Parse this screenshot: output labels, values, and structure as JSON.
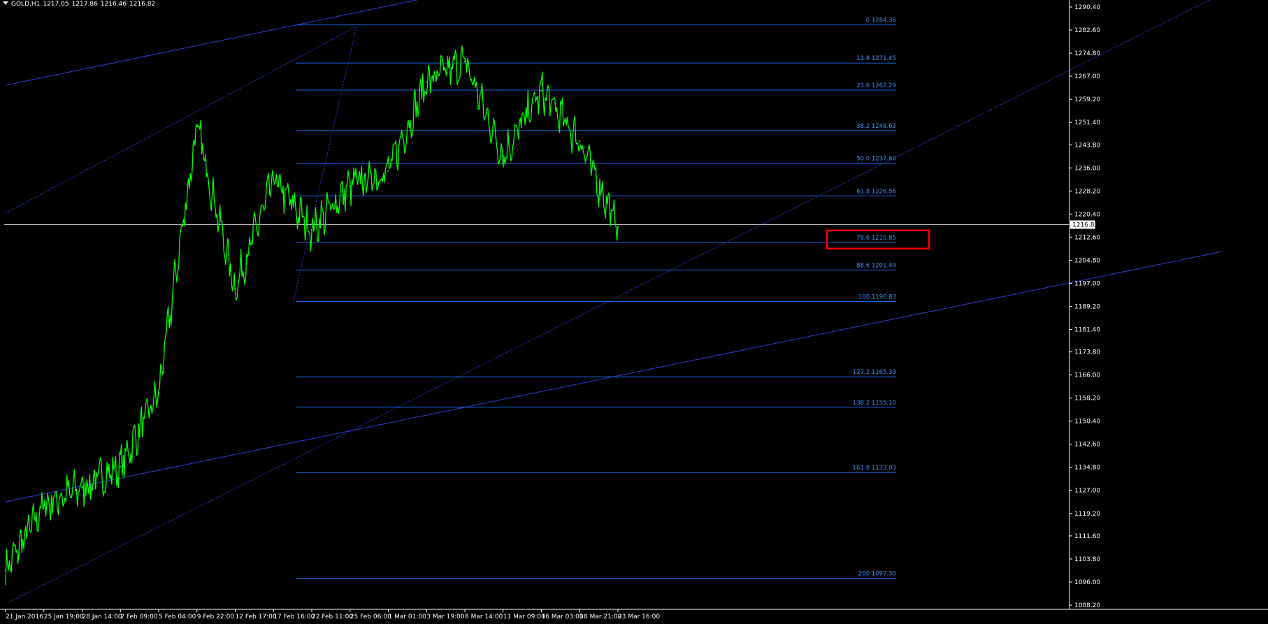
{
  "header": {
    "symbol": "GOLD,H1",
    "open": "1217.05",
    "high": "1217.86",
    "low": "1216.46",
    "close": "1216.82"
  },
  "colors": {
    "background": "#000000",
    "candles": "#00ff00",
    "fibo": "#1e66e6",
    "fibo_label": "#3d8ef0",
    "trendline": "#2f3fd8",
    "channel_dotted": "#2a3fd6",
    "axis": "#ffffff",
    "bid_line": "#c8c8c8",
    "highlight_box": "#ff0000"
  },
  "chart_data": {
    "type": "line",
    "title": "",
    "instrument": "GOLD",
    "timeframe": "H1",
    "current_price": "1216.82",
    "ylim": [
      1088.2,
      1294.0
    ],
    "y_ticks": [
      "1290.40",
      "1282.60",
      "1274.80",
      "1267.00",
      "1259.20",
      "1251.40",
      "1243.80",
      "1236.00",
      "1228.20",
      "1220.40",
      "1212.60",
      "1204.80",
      "1197.00",
      "1189.20",
      "1181.40",
      "1173.80",
      "1166.00",
      "1158.20",
      "1150.40",
      "1142.60",
      "1134.80",
      "1127.00",
      "1119.20",
      "1111.60",
      "1103.80",
      "1096.00",
      "1088.20"
    ],
    "x_ticks": [
      "21 Jan 2016",
      "25 Jan 19:00",
      "28 Jan 14:00",
      "2 Feb 09:00",
      "5 Feb 04:00",
      "9 Feb 22:00",
      "12 Feb 17:00",
      "17 Feb 16:00",
      "22 Feb 11:00",
      "25 Feb 06:00",
      "1 Mar 01:00",
      "3 Mar 19:00",
      "8 Mar 14:00",
      "11 Mar 09:00",
      "16 Mar 03:00",
      "18 Mar 21:00",
      "23 Mar 16:00"
    ],
    "series": [
      {
        "values_by_x_tick": [
          1100,
          1122,
          1128,
          1135,
          1160,
          1250,
          1195,
          1232,
          1215,
          1230,
          1235,
          1265,
          1272,
          1240,
          1262,
          1245,
          1216
        ]
      }
    ],
    "fibonacci_levels": [
      {
        "level": "0",
        "price": "1284.36"
      },
      {
        "level": "13.8",
        "price": "1271.45"
      },
      {
        "level": "23.6",
        "price": "1262.29"
      },
      {
        "level": "38.2",
        "price": "1248.63"
      },
      {
        "level": "50.0",
        "price": "1237.60"
      },
      {
        "level": "61.8",
        "price": "1226.56"
      },
      {
        "level": "78.6",
        "price": "1210.85",
        "highlighted": true
      },
      {
        "level": "88.6",
        "price": "1201.49"
      },
      {
        "level": "100",
        "price": "1190.83"
      },
      {
        "level": "127.2",
        "price": "1165.39"
      },
      {
        "level": "138.2",
        "price": "1155.10"
      },
      {
        "level": "161.8",
        "price": "1133.03"
      },
      {
        "level": "200",
        "price": "1097.30"
      }
    ],
    "grid": false,
    "legend": "none"
  }
}
